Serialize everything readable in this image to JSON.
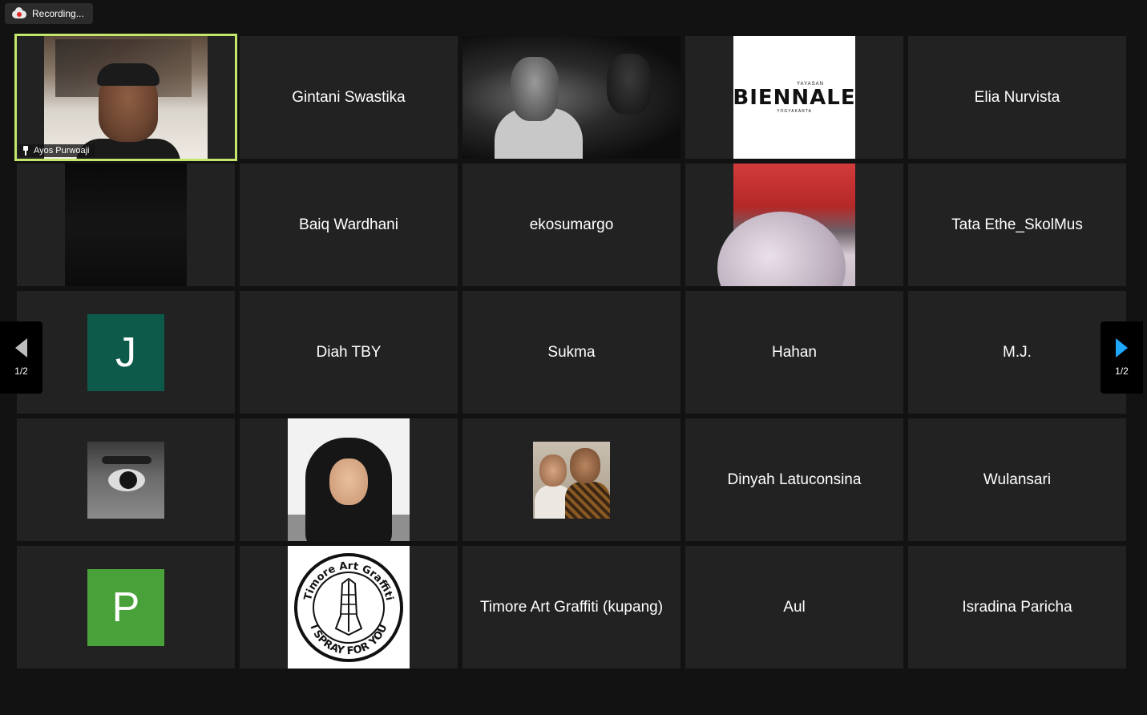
{
  "recording": {
    "label": "Recording..."
  },
  "pager": {
    "left_page": "1/2",
    "right_page": "1/2"
  },
  "active_speaker": {
    "name": "Ayos Purwoaji"
  },
  "tiles": {
    "r1c2": "Gintani Swastika",
    "r1c5": "Elia Nurvista",
    "r2c2": "Baiq Wardhani",
    "r2c3": "ekosumargo",
    "r2c5": "Tata Ethe_SkolMus",
    "r3c1_initial": "J",
    "r3c2": "Diah TBY",
    "r3c3": "Sukma",
    "r3c4": "Hahan",
    "r3c5": "M.J.",
    "r4c4": "Dinyah Latuconsina",
    "r4c5": "Wulansari",
    "r5c1_initial": "P",
    "r5c3": "Timore Art Graffiti (kupang)",
    "r5c4": "Aul",
    "r5c5": "Isradina Paricha"
  },
  "logos": {
    "biennale_top": "YAYASAN",
    "biennale_main": "BIENNALE",
    "biennale_bottom": "YOGYAKARTA",
    "stamp_top": "Timore Art Graffiti",
    "stamp_bottom": "I SPRAY FOR YOU"
  },
  "colors": {
    "active_border": "#c3e66b",
    "avatar_j": "#0d5a4b",
    "avatar_p": "#49a13a",
    "tile_bg": "#222222",
    "pager_arrow_active": "#1ea7fd"
  }
}
